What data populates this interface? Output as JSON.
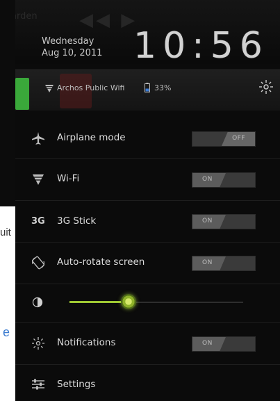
{
  "background": {
    "left_text_1": "uit",
    "left_text_2": "e"
  },
  "header": {
    "ghost_text": "arden",
    "day": "Wednesday",
    "date": "Aug 10, 2011",
    "time": "10:56"
  },
  "status": {
    "network": "Archos Public Wifi",
    "battery": "33%"
  },
  "rows": {
    "airplane": {
      "label": "Airplane mode",
      "state": "OFF"
    },
    "wifi": {
      "label": "Wi-Fi",
      "state": "ON"
    },
    "stick3g": {
      "icon_text": "3G",
      "label": "3G Stick",
      "state": "ON"
    },
    "autorotate": {
      "label": "Auto-rotate screen",
      "state": "ON"
    },
    "notifications": {
      "label": "Notifications",
      "state": "ON"
    },
    "settings": {
      "label": "Settings"
    }
  },
  "brightness": {
    "level": 0.34,
    "accent": "#9ec832"
  },
  "icons": {
    "airplane": "airplane-icon",
    "wifi": "wifi-icon",
    "autorotate": "rotate-icon",
    "brightness": "brightness-icon",
    "notifications": "notifications-icon",
    "settings": "settings-sliders-icon"
  }
}
